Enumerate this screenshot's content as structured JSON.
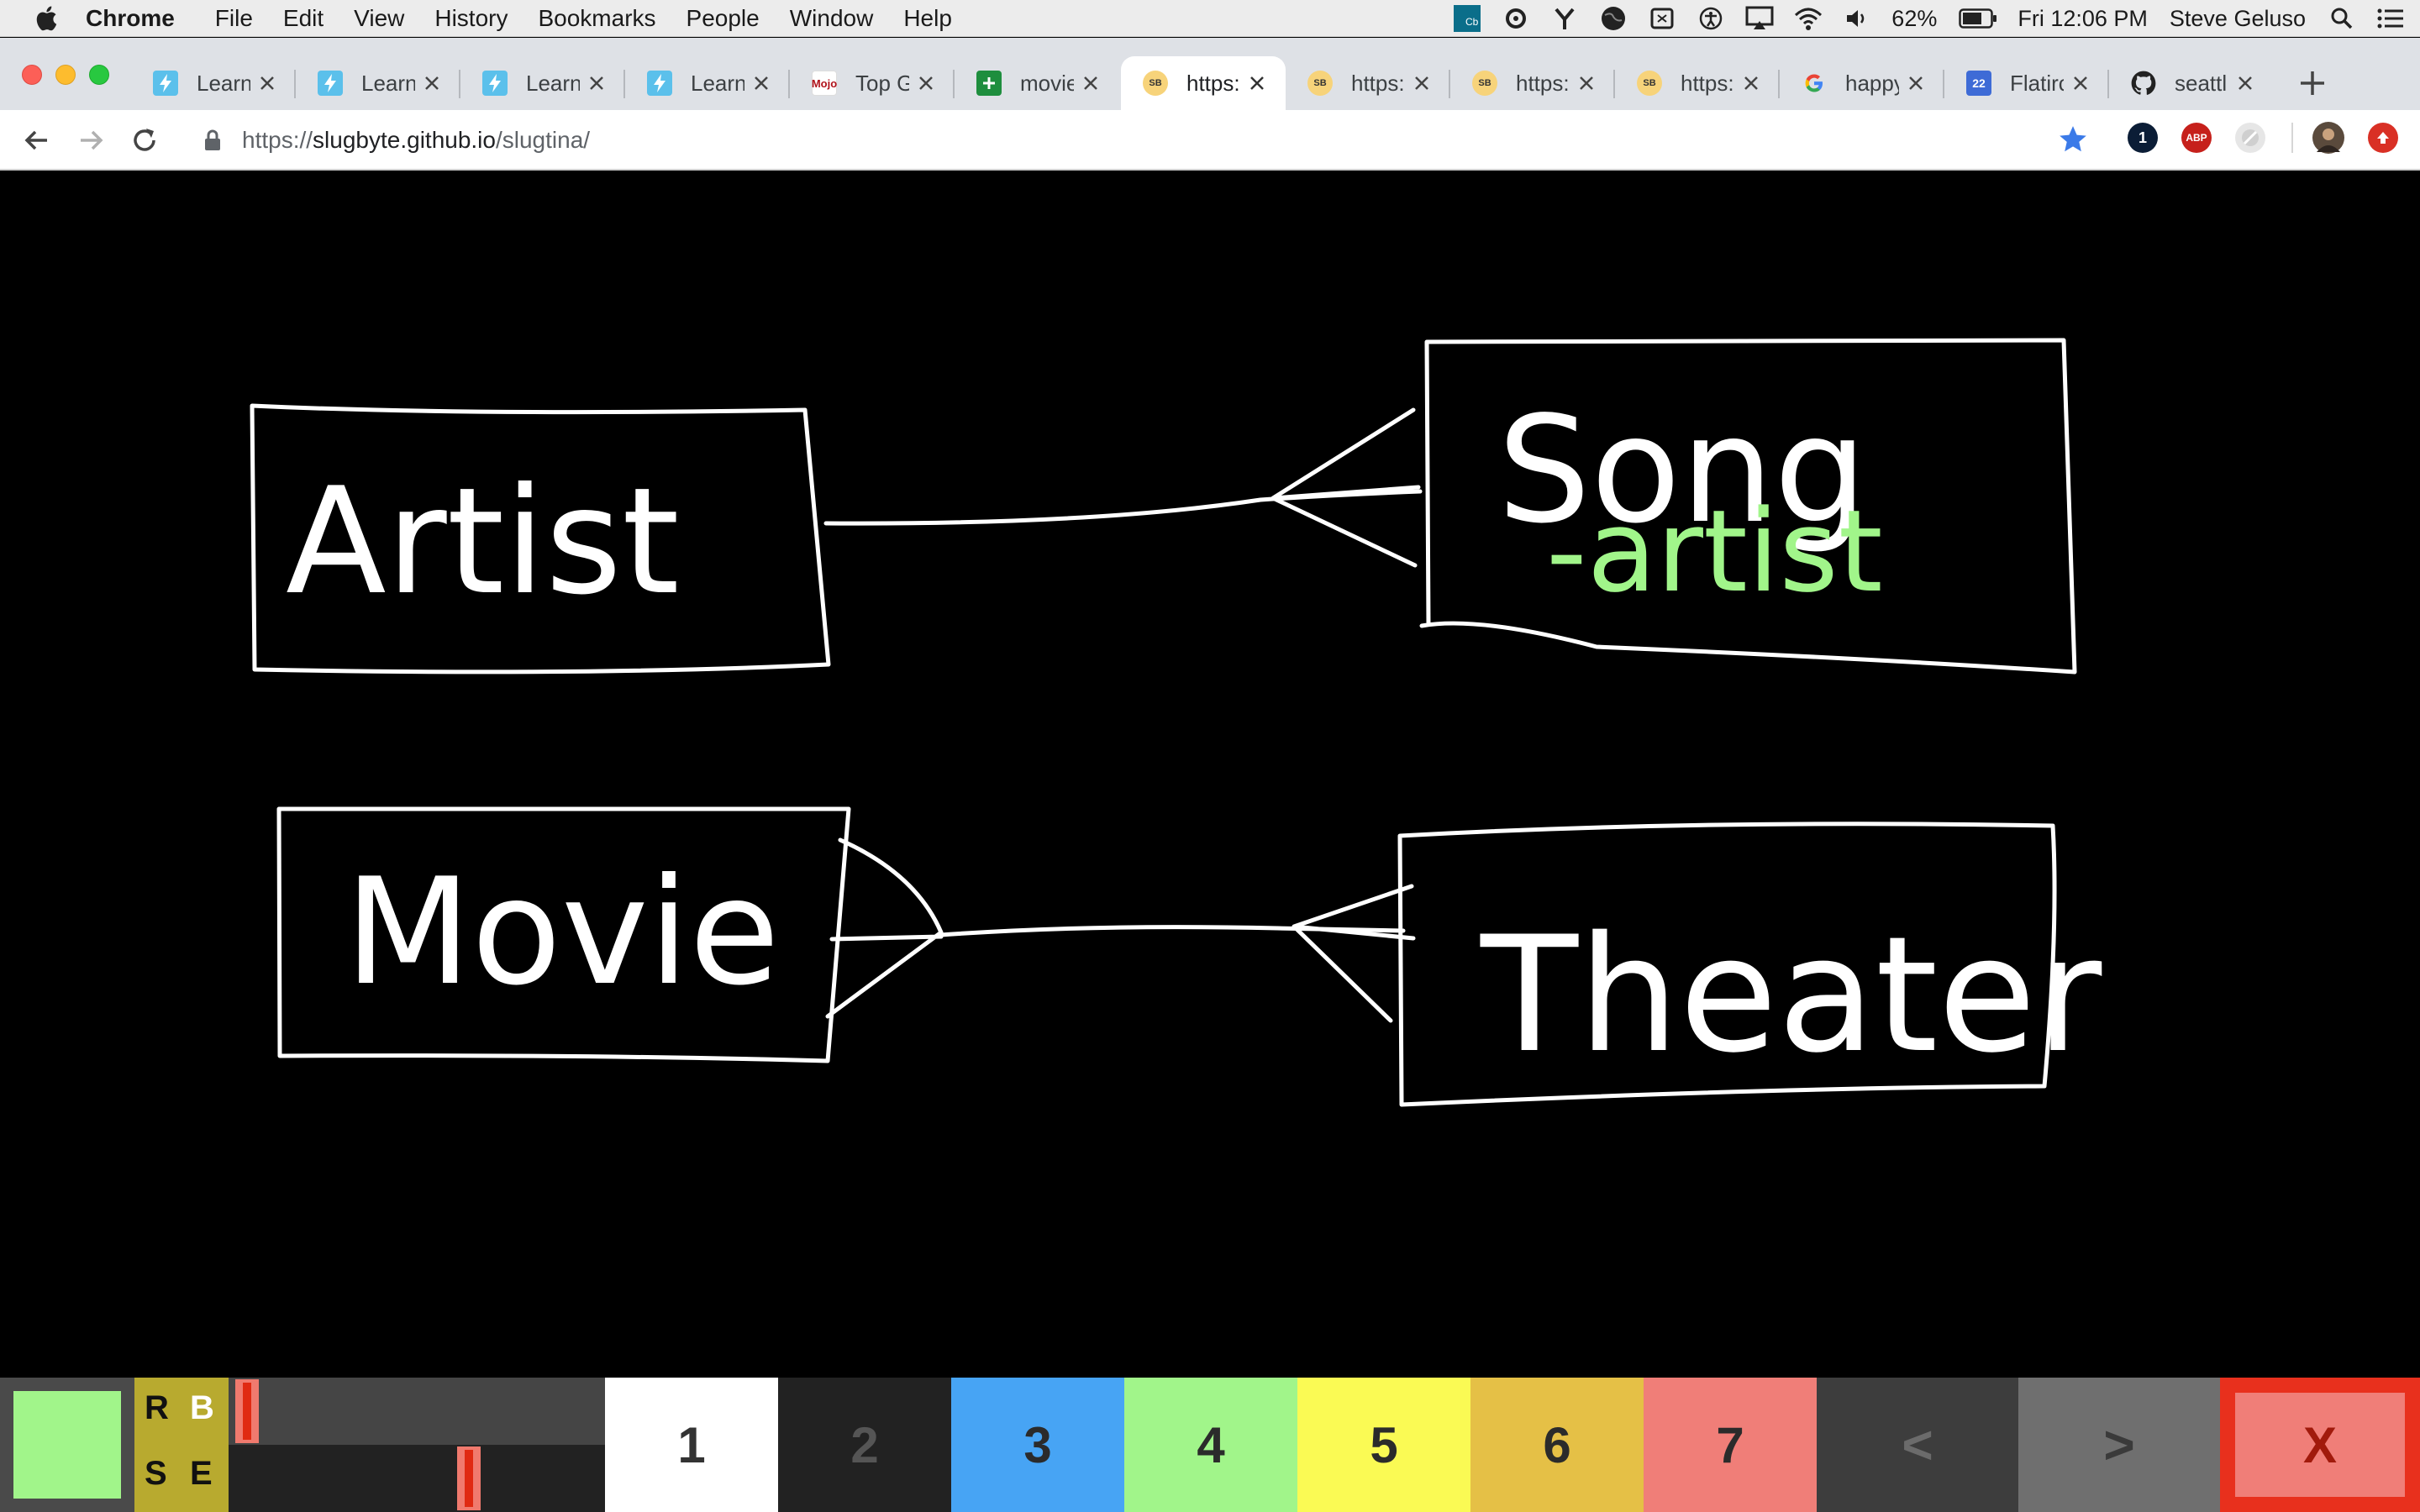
{
  "menubar": {
    "app": "Chrome",
    "menus": [
      "File",
      "Edit",
      "View",
      "History",
      "Bookmarks",
      "People",
      "Window",
      "Help"
    ],
    "battery": "62%",
    "clock": "Fri 12:06 PM",
    "user": "Steve Geluso",
    "badge": "Cb"
  },
  "tabs": [
    {
      "title": "Learn",
      "icon": "learn-bolt-icon"
    },
    {
      "title": "Learn",
      "icon": "learn-bolt-icon"
    },
    {
      "title": "Learn",
      "icon": "learn-bolt-icon"
    },
    {
      "title": "Learn",
      "icon": "learn-bolt-icon"
    },
    {
      "title": "Top G",
      "icon": "box-office-mojo-icon",
      "badge": "Mojo"
    },
    {
      "title": "movie",
      "icon": "sheets-icon"
    },
    {
      "title": "https:",
      "icon": "slugbyte-icon",
      "active": true
    },
    {
      "title": "https:",
      "icon": "slugbyte-icon"
    },
    {
      "title": "https:",
      "icon": "slugbyte-icon"
    },
    {
      "title": "https:",
      "icon": "slugbyte-icon"
    },
    {
      "title": "happy",
      "icon": "google-icon"
    },
    {
      "title": "Flatirc",
      "icon": "calendar-icon",
      "badge": "22"
    },
    {
      "title": "seattl",
      "icon": "github-icon"
    }
  ],
  "address": {
    "scheme": "https://",
    "host": "slugbyte.github.io",
    "path": "/slugtina/"
  },
  "extensions": {
    "one": "1",
    "abp": "ABP"
  },
  "diagram": {
    "box1": "Artist",
    "box2": "Song",
    "box2_field": "-artist",
    "box3": "Movie",
    "box4": "Theater"
  },
  "palette": {
    "mode_r": "R",
    "mode_b": "B",
    "mode_s": "S",
    "mode_e": "E",
    "colors": [
      {
        "label": "1",
        "bg": "#ffffff",
        "fg": "#333333"
      },
      {
        "label": "2",
        "bg": "#222222",
        "fg": "#555555"
      },
      {
        "label": "3",
        "bg": "#47a4f4",
        "fg": "#2b2b2b"
      },
      {
        "label": "4",
        "bg": "#a1f58a",
        "fg": "#2b2b2b"
      },
      {
        "label": "5",
        "bg": "#fafa54",
        "fg": "#2b2b2b"
      },
      {
        "label": "6",
        "bg": "#e5c046",
        "fg": "#2b2b2b"
      },
      {
        "label": "7",
        "bg": "#f07e78",
        "fg": "#2b2b2b"
      }
    ],
    "prev": "<",
    "next": ">",
    "exit": "X",
    "current_color": "#a1f58a"
  }
}
